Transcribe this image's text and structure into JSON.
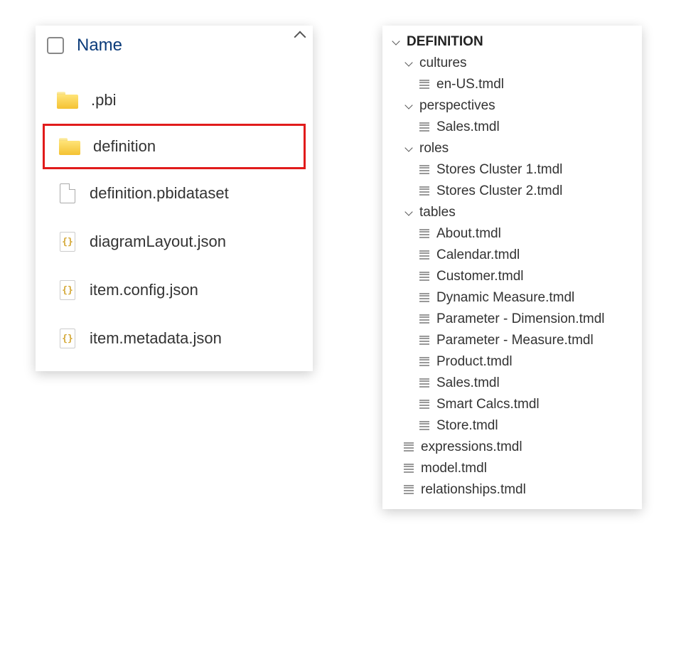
{
  "explorer": {
    "header": "Name",
    "items": [
      {
        "type": "folder",
        "label": ".pbi",
        "highlighted": false
      },
      {
        "type": "folder",
        "label": "definition",
        "highlighted": true
      },
      {
        "type": "file",
        "label": "definition.pbidataset"
      },
      {
        "type": "json",
        "label": "diagramLayout.json"
      },
      {
        "type": "json",
        "label": "item.config.json"
      },
      {
        "type": "json",
        "label": "item.metadata.json"
      }
    ]
  },
  "tree": {
    "root": "DEFINITION",
    "folders": [
      {
        "name": "cultures",
        "files": [
          "en-US.tmdl"
        ]
      },
      {
        "name": "perspectives",
        "files": [
          "Sales.tmdl"
        ]
      },
      {
        "name": "roles",
        "files": [
          "Stores Cluster 1.tmdl",
          "Stores Cluster 2.tmdl"
        ]
      },
      {
        "name": "tables",
        "files": [
          "About.tmdl",
          "Calendar.tmdl",
          "Customer.tmdl",
          "Dynamic Measure.tmdl",
          "Parameter - Dimension.tmdl",
          "Parameter - Measure.tmdl",
          "Product.tmdl",
          "Sales.tmdl",
          "Smart Calcs.tmdl",
          "Store.tmdl"
        ]
      }
    ],
    "rootFiles": [
      "expressions.tmdl",
      "model.tmdl",
      "relationships.tmdl"
    ]
  }
}
